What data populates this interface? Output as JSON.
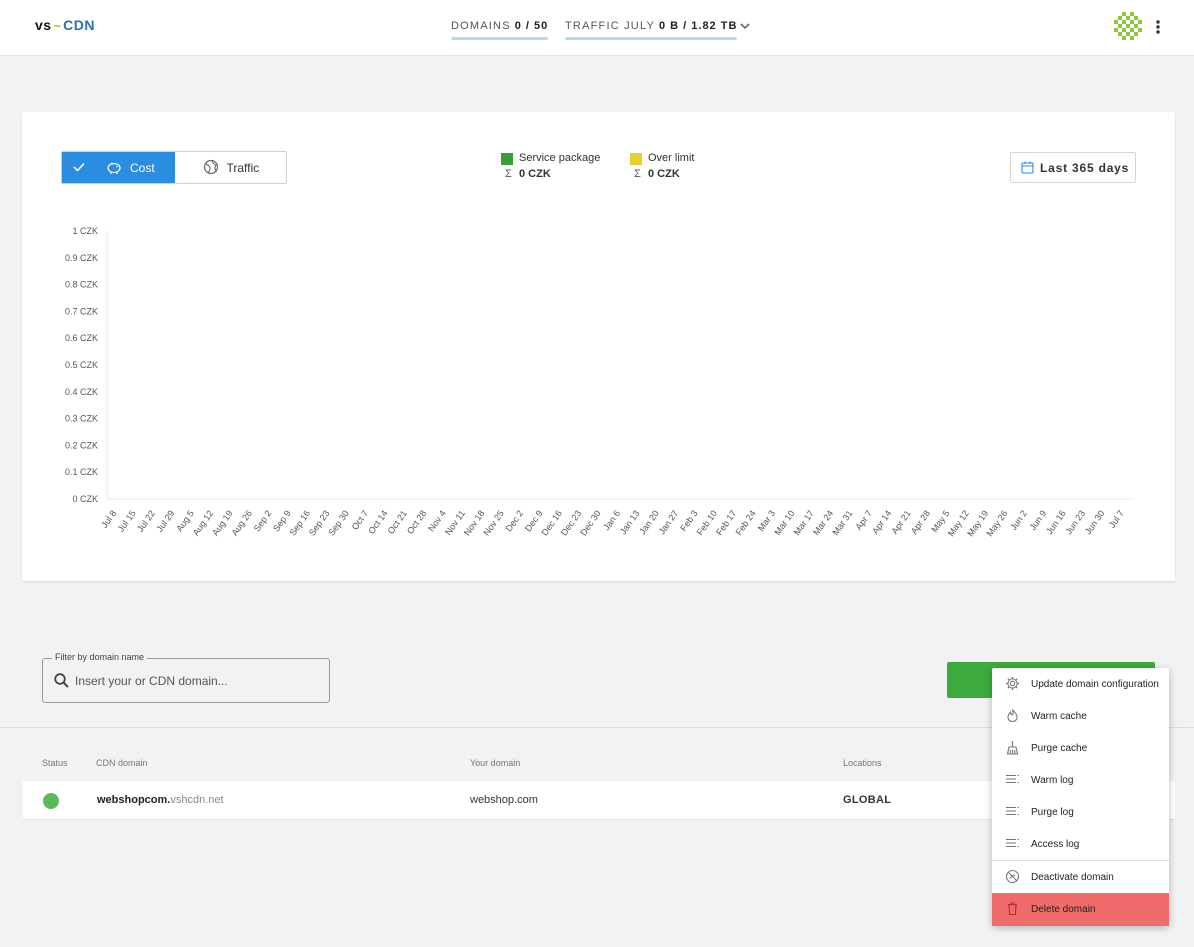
{
  "header": {
    "logo": {
      "vs": "vs",
      "tilde": "~",
      "cdn": "CDN"
    },
    "domains_label": "DOMAINS",
    "domains_value": "0 / 50",
    "traffic_label": "TRAFFIC JULY",
    "traffic_value": "0 B / 1.82 TB"
  },
  "chart_card": {
    "toggle": {
      "cost": "Cost",
      "traffic": "Traffic",
      "active": "Cost"
    },
    "legend": [
      {
        "name": "Service package",
        "value": "0 CZK",
        "color": "#3a9d3a"
      },
      {
        "name": "Over limit",
        "value": "0 CZK",
        "color": "#e6cf33"
      }
    ],
    "sigma": "Σ",
    "date_range": "Last 365 days"
  },
  "chart_data": {
    "type": "bar",
    "title": "",
    "xlabel": "",
    "ylabel": "",
    "ylim": [
      0,
      1
    ],
    "y_ticks": [
      "0 CZK",
      "0.1 CZK",
      "0.2 CZK",
      "0.3 CZK",
      "0.4 CZK",
      "0.5 CZK",
      "0.6 CZK",
      "0.7 CZK",
      "0.8 CZK",
      "0.9 CZK",
      "1 CZK"
    ],
    "categories": [
      "Jul 8",
      "Jul 15",
      "Jul 22",
      "Jul 29",
      "Aug 5",
      "Aug 12",
      "Aug 19",
      "Aug 26",
      "Sep 2",
      "Sep 9",
      "Sep 16",
      "Sep 23",
      "Sep 30",
      "Oct 7",
      "Oct 14",
      "Oct 21",
      "Oct 28",
      "Nov 4",
      "Nov 11",
      "Nov 18",
      "Nov 25",
      "Dec 2",
      "Dec 9",
      "Dec 16",
      "Dec 23",
      "Dec 30",
      "Jan 6",
      "Jan 13",
      "Jan 20",
      "Jan 27",
      "Feb 3",
      "Feb 10",
      "Feb 17",
      "Feb 24",
      "Mar 3",
      "Mar 10",
      "Mar 17",
      "Mar 24",
      "Mar 31",
      "Apr 7",
      "Apr 14",
      "Apr 21",
      "Apr 28",
      "May 5",
      "May 12",
      "May 19",
      "May 26",
      "Jun 2",
      "Jun 9",
      "Jun 16",
      "Jun 23",
      "Jun 30",
      "Jul 7"
    ],
    "series": [
      {
        "name": "Service package",
        "values": [
          0,
          0,
          0,
          0,
          0,
          0,
          0,
          0,
          0,
          0,
          0,
          0,
          0,
          0,
          0,
          0,
          0,
          0,
          0,
          0,
          0,
          0,
          0,
          0,
          0,
          0,
          0,
          0,
          0,
          0,
          0,
          0,
          0,
          0,
          0,
          0,
          0,
          0,
          0,
          0,
          0,
          0,
          0,
          0,
          0,
          0,
          0,
          0,
          0,
          0,
          0,
          0,
          0
        ]
      },
      {
        "name": "Over limit",
        "values": [
          0,
          0,
          0,
          0,
          0,
          0,
          0,
          0,
          0,
          0,
          0,
          0,
          0,
          0,
          0,
          0,
          0,
          0,
          0,
          0,
          0,
          0,
          0,
          0,
          0,
          0,
          0,
          0,
          0,
          0,
          0,
          0,
          0,
          0,
          0,
          0,
          0,
          0,
          0,
          0,
          0,
          0,
          0,
          0,
          0,
          0,
          0,
          0,
          0,
          0,
          0,
          0,
          0
        ]
      }
    ],
    "grid": false,
    "legend_position": "top-center"
  },
  "filter": {
    "label": "Filter by domain name",
    "placeholder": "Insert your or CDN domain...",
    "value": ""
  },
  "table": {
    "headers": {
      "status": "Status",
      "cdn_domain": "CDN domain",
      "your_domain": "Your domain",
      "locations": "Locations"
    },
    "rows": [
      {
        "status": "active",
        "cdn_prefix": "webshopcom.",
        "cdn_suffix": "vshcdn.net",
        "your_domain": "webshop.com",
        "location": "GLOBAL"
      }
    ]
  },
  "menu": {
    "items": [
      {
        "label": "Update domain configuration",
        "icon": "gear-icon"
      },
      {
        "label": "Warm cache",
        "icon": "flame-icon"
      },
      {
        "label": "Purge cache",
        "icon": "broom-icon"
      },
      {
        "label": "Warm log",
        "icon": "list-icon"
      },
      {
        "label": "Purge log",
        "icon": "list-icon"
      },
      {
        "label": "Access log",
        "icon": "list-icon"
      },
      {
        "label": "Deactivate domain",
        "icon": "deactivate-icon"
      },
      {
        "label": "Delete domain",
        "icon": "trash-icon"
      }
    ],
    "danger_color": "#f06b6b"
  }
}
